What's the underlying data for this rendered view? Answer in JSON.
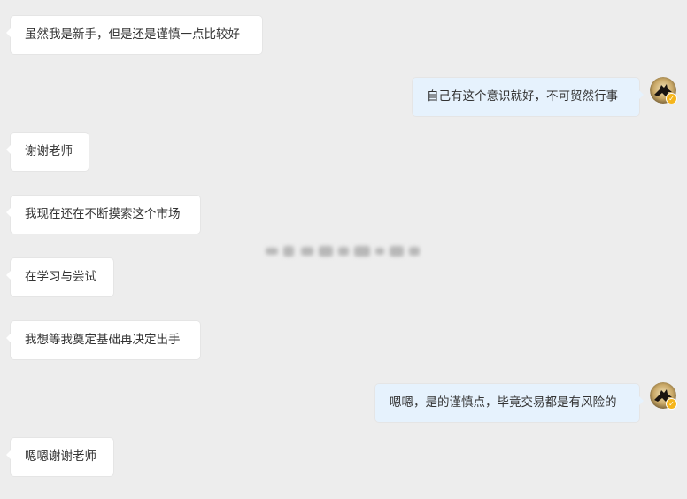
{
  "messages": [
    {
      "side": "left",
      "text": "虽然我是新手，但是还是谨慎一点比较好"
    },
    {
      "side": "right",
      "text": "自己有这个意识就好，不可贸然行事"
    },
    {
      "side": "left",
      "text": "谢谢老师"
    },
    {
      "side": "left",
      "text": "我现在还在不断摸索这个市场"
    },
    {
      "side": "left",
      "text": "在学习与尝试"
    },
    {
      "side": "left",
      "text": "我想等我奠定基础再决定出手"
    },
    {
      "side": "right",
      "text": "嗯嗯，是的谨慎点，毕竟交易都是有风险的"
    },
    {
      "side": "left",
      "text": "嗯嗯谢谢老师"
    }
  ],
  "colors": {
    "background": "#ededed",
    "left_bubble": "#ffffff",
    "right_bubble": "#e6f2fd",
    "text": "#333333",
    "badge": "#f5b51b"
  },
  "icons": {
    "teacher_avatar": "silhouette-avatar-icon",
    "verified_badge": "verified-badge-icon",
    "redacted_name": "blurred-name-icon"
  }
}
